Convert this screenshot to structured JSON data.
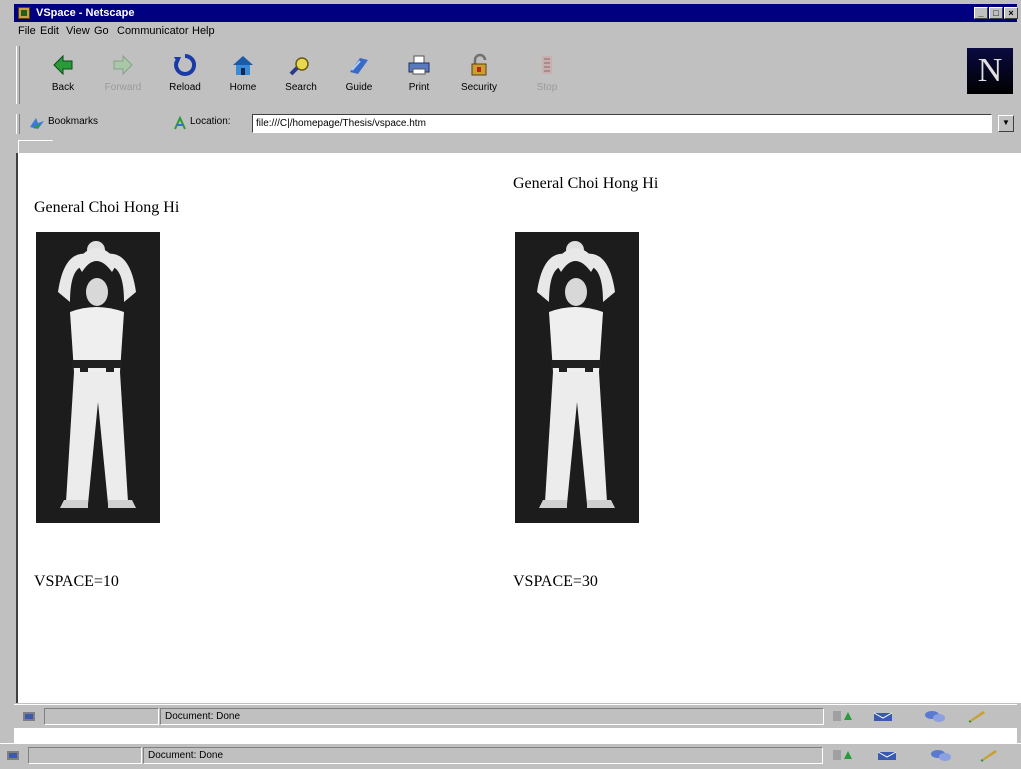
{
  "window": {
    "title": "VSpace - Netscape",
    "controls": {
      "minimize": "_",
      "maximize": "□",
      "close": "×"
    }
  },
  "menu": [
    "File",
    "Edit",
    "View",
    "Go",
    "Communicator",
    "Help"
  ],
  "toolbar": {
    "buttons": [
      {
        "label": "Back",
        "icon": "back-arrow-icon",
        "enabled": true
      },
      {
        "label": "Forward",
        "icon": "forward-arrow-icon",
        "enabled": false
      },
      {
        "label": "Reload",
        "icon": "reload-icon",
        "enabled": true
      },
      {
        "label": "Home",
        "icon": "home-icon",
        "enabled": true
      },
      {
        "label": "Search",
        "icon": "search-icon",
        "enabled": true
      },
      {
        "label": "Guide",
        "icon": "guide-icon",
        "enabled": true
      },
      {
        "label": "Print",
        "icon": "print-icon",
        "enabled": true
      },
      {
        "label": "Security",
        "icon": "security-lock-icon",
        "enabled": true
      },
      {
        "label": "Stop",
        "icon": "stop-icon",
        "enabled": false
      }
    ],
    "logo": "N"
  },
  "location": {
    "bookmarks_label": "Bookmarks",
    "location_label": "Location:",
    "url": "file:///C|/homepage/Thesis/vspace.htm"
  },
  "page": {
    "left": {
      "caption": "General Choi Hong Hi",
      "vspace_label": "VSPACE=10"
    },
    "right": {
      "caption": "General Choi Hong Hi",
      "vspace_label": "VSPACE=30"
    }
  },
  "status": {
    "text": "Document: Done"
  },
  "colors": {
    "titlebar": "#000080",
    "chrome": "#c0c0c0",
    "content_bg": "#ffffff"
  }
}
